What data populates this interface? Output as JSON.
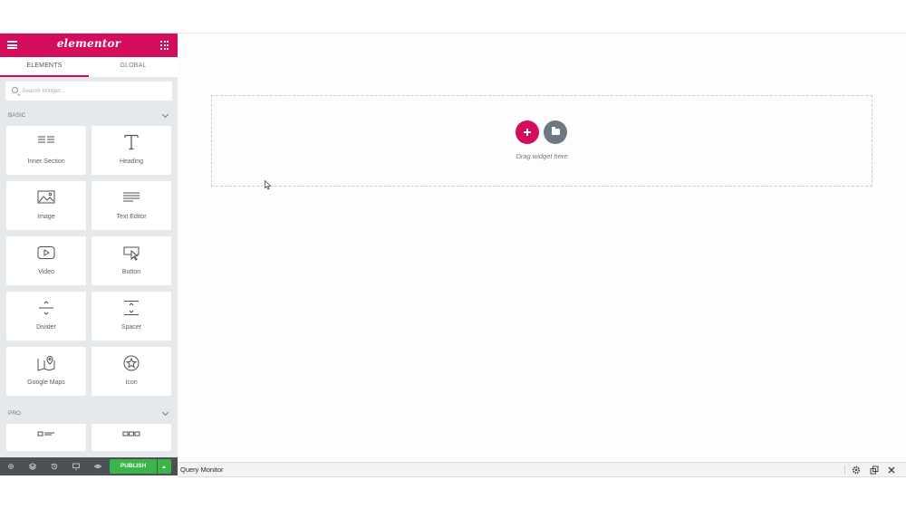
{
  "panel": {
    "logo": "elementor",
    "tabs": [
      {
        "label": "ELEMENTS",
        "active": true
      },
      {
        "label": "GLOBAL",
        "active": false
      }
    ],
    "search_placeholder": "Search Widget...",
    "categories": {
      "basic": "BASIC",
      "pro": "PRO"
    },
    "widgets": [
      {
        "label": "Inner Section",
        "icon": "inner-section-icon"
      },
      {
        "label": "Heading",
        "icon": "heading-icon"
      },
      {
        "label": "Image",
        "icon": "image-icon"
      },
      {
        "label": "Text Editor",
        "icon": "text-editor-icon"
      },
      {
        "label": "Video",
        "icon": "video-icon"
      },
      {
        "label": "Button",
        "icon": "button-icon"
      },
      {
        "label": "Divider",
        "icon": "divider-icon"
      },
      {
        "label": "Spacer",
        "icon": "spacer-icon"
      },
      {
        "label": "Google Maps",
        "icon": "google-maps-icon"
      },
      {
        "label": "Icon",
        "icon": "star-icon"
      }
    ]
  },
  "canvas": {
    "drag_text": "Drag widget here"
  },
  "footer": {
    "publish_label": "PUBLISH"
  },
  "query_monitor": {
    "title": "Query Monitor"
  },
  "colors": {
    "brand": "#d30c5c",
    "publish": "#39b54a",
    "panel_bg": "#e6e9ec",
    "footer_bg": "#495157"
  }
}
